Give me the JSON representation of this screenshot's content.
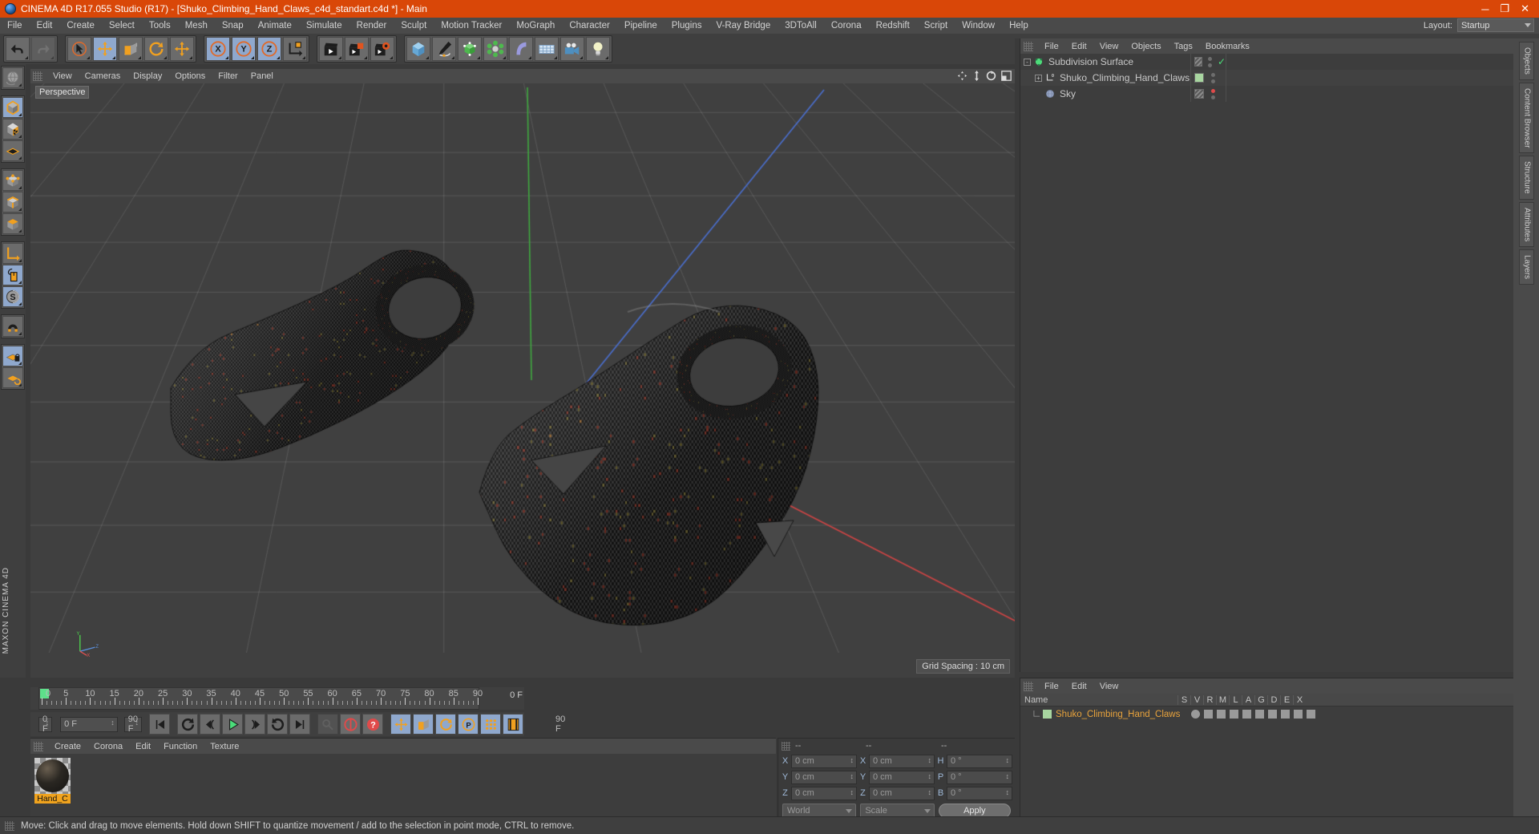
{
  "window": {
    "title": "CINEMA 4D R17.055 Studio (R17) - [Shuko_Climbing_Hand_Claws_c4d_standart.c4d *] - Main",
    "minimize": "─",
    "maximize": "❐",
    "close": "✕"
  },
  "menubar": {
    "items": [
      "File",
      "Edit",
      "Create",
      "Select",
      "Tools",
      "Mesh",
      "Snap",
      "Animate",
      "Simulate",
      "Render",
      "Sculpt",
      "Motion Tracker",
      "MoGraph",
      "Character",
      "Pipeline",
      "Plugins",
      "V-Ray Bridge",
      "3DToAll",
      "Corona",
      "Redshift",
      "Script",
      "Window",
      "Help"
    ],
    "layout_label": "Layout:",
    "layout_value": "Startup"
  },
  "toolbar": {
    "groups": [
      {
        "name": "undo-redo",
        "buttons": [
          {
            "name": "undo-button",
            "icon": "undo",
            "state": "normal"
          },
          {
            "name": "redo-button",
            "icon": "redo",
            "state": "disabled"
          }
        ]
      },
      {
        "name": "transform-tools",
        "buttons": [
          {
            "name": "live-selection-tool",
            "icon": "cursor",
            "state": "normal"
          },
          {
            "name": "move-tool",
            "icon": "move",
            "state": "active"
          },
          {
            "name": "scale-tool",
            "icon": "scale",
            "state": "normal"
          },
          {
            "name": "rotate-tool",
            "icon": "rotate",
            "state": "normal"
          },
          {
            "name": "move-alt-tool",
            "icon": "move",
            "state": "normal"
          }
        ]
      },
      {
        "name": "axis-locks",
        "buttons": [
          {
            "name": "lock-x-axis",
            "icon": "X",
            "state": "active"
          },
          {
            "name": "lock-y-axis",
            "icon": "Y",
            "state": "active"
          },
          {
            "name": "lock-z-axis",
            "icon": "Z",
            "state": "active"
          },
          {
            "name": "world-object-coordinates",
            "icon": "axis-cube",
            "state": "normal"
          }
        ]
      },
      {
        "name": "render-tools",
        "buttons": [
          {
            "name": "render-view-button",
            "icon": "clapper",
            "state": "normal"
          },
          {
            "name": "render-to-picture-viewer-button",
            "icon": "clapper-pv",
            "state": "normal"
          },
          {
            "name": "render-settings-button",
            "icon": "clapper-gear",
            "state": "normal"
          }
        ]
      },
      {
        "name": "create-objects",
        "buttons": [
          {
            "name": "add-cube-button",
            "icon": "cube",
            "state": "normal"
          },
          {
            "name": "add-spline-button",
            "icon": "pen",
            "state": "normal"
          },
          {
            "name": "add-generator-button",
            "icon": "generator",
            "state": "normal"
          },
          {
            "name": "add-deformer-button",
            "icon": "deformer",
            "state": "normal"
          },
          {
            "name": "add-bend-button",
            "icon": "bend",
            "state": "normal"
          },
          {
            "name": "add-floor-button",
            "icon": "floor",
            "state": "normal"
          },
          {
            "name": "add-camera-button",
            "icon": "camera",
            "state": "normal"
          },
          {
            "name": "add-light-button",
            "icon": "light",
            "state": "normal"
          }
        ]
      }
    ]
  },
  "left_toolbar": {
    "groups": [
      [
        {
          "name": "undo-view-button",
          "icon": "globe",
          "state": "normal"
        }
      ],
      [
        {
          "name": "model-mode-button",
          "icon": "model-cube",
          "state": "active"
        },
        {
          "name": "texture-mode-button",
          "icon": "texture-cube",
          "state": "normal"
        },
        {
          "name": "workplane-mode-button",
          "icon": "workplane",
          "state": "normal"
        }
      ],
      [
        {
          "name": "points-mode-button",
          "icon": "points-cube",
          "state": "normal"
        },
        {
          "name": "edges-mode-button",
          "icon": "edges-cube",
          "state": "normal"
        },
        {
          "name": "polygons-mode-button",
          "icon": "polygons-cube",
          "state": "normal"
        }
      ],
      [
        {
          "name": "object-axis-mode-button",
          "icon": "axis",
          "state": "normal"
        },
        {
          "name": "enable-axis-modification-button",
          "icon": "mouse",
          "state": "active"
        },
        {
          "name": "soft-selection-button",
          "icon": "s-disc",
          "state": "active"
        }
      ],
      [
        {
          "name": "snap-settings-button",
          "icon": "magnet",
          "state": "normal"
        }
      ],
      [
        {
          "name": "workplane-lock-button",
          "icon": "plane-lock",
          "state": "active"
        },
        {
          "name": "planar-workplane-button",
          "icon": "plane-rotate",
          "state": "normal"
        }
      ]
    ],
    "brand": "MAXON  CINEMA 4D"
  },
  "viewport": {
    "menu": [
      "View",
      "Cameras",
      "Display",
      "Options",
      "Filter",
      "Panel"
    ],
    "label": "Perspective",
    "grid_spacing": "Grid Spacing : 10 cm",
    "nav_icons": [
      "pan-icon",
      "dolly-icon",
      "orbit-icon",
      "maximize-viewport-icon"
    ],
    "axis": {
      "x": "X",
      "y": "Y",
      "z": "Z"
    }
  },
  "object_manager": {
    "menu": [
      "File",
      "Edit",
      "View",
      "Objects",
      "Tags",
      "Bookmarks"
    ],
    "rows": [
      {
        "name": "Subdivision Surface",
        "icon": "subdivision-surface-icon",
        "depth": 0,
        "expander": "-",
        "tag": "hatched",
        "check": true
      },
      {
        "name": "Shuko_Climbing_Hand_Claws",
        "icon": "null-object-icon",
        "depth": 1,
        "expander": "+",
        "tag": "green",
        "check": false
      },
      {
        "name": "Sky",
        "icon": "sky-icon",
        "depth": 1,
        "expander": "",
        "tag": "hatched",
        "check": false,
        "reddot": true
      }
    ]
  },
  "timeline": {
    "ticks": [
      {
        "label": "0",
        "frame": 0
      },
      {
        "label": "5",
        "frame": 5
      },
      {
        "label": "10",
        "frame": 10
      },
      {
        "label": "15",
        "frame": 15
      },
      {
        "label": "20",
        "frame": 20
      },
      {
        "label": "25",
        "frame": 25
      },
      {
        "label": "30",
        "frame": 30
      },
      {
        "label": "35",
        "frame": 35
      },
      {
        "label": "40",
        "frame": 40
      },
      {
        "label": "45",
        "frame": 45
      },
      {
        "label": "50",
        "frame": 50
      },
      {
        "label": "55",
        "frame": 55
      },
      {
        "label": "60",
        "frame": 60
      },
      {
        "label": "65",
        "frame": 65
      },
      {
        "label": "70",
        "frame": 70
      },
      {
        "label": "75",
        "frame": 75
      },
      {
        "label": "80",
        "frame": 80
      },
      {
        "label": "85",
        "frame": 85
      },
      {
        "label": "90",
        "frame": 90
      }
    ],
    "max_frame": 90,
    "end_field": "0 F"
  },
  "playback": {
    "current_frame_field": "0 F",
    "start_frame_field": "0 F",
    "preview_end_field": "90 F",
    "end_frame_field": "90 F",
    "buttons": [
      {
        "name": "go-to-start-button",
        "icon": "skip-start",
        "state": "normal"
      },
      {
        "name": "play-backwards-button",
        "icon": "rewind-loop",
        "state": "normal"
      },
      {
        "name": "previous-frame-button",
        "icon": "step-back",
        "state": "normal"
      },
      {
        "name": "play-button",
        "icon": "play",
        "state": "normal"
      },
      {
        "name": "next-frame-button",
        "icon": "step-forward",
        "state": "normal"
      },
      {
        "name": "play-forwards-button",
        "icon": "forward-loop",
        "state": "normal"
      },
      {
        "name": "go-to-end-button",
        "icon": "skip-end",
        "state": "normal"
      },
      {
        "name": "record-active-objects-button",
        "icon": "key",
        "state": "disabled"
      },
      {
        "name": "autokeying-button",
        "icon": "autokey",
        "state": "normal"
      },
      {
        "name": "keyframe-selection-button",
        "icon": "question",
        "state": "normal"
      },
      {
        "name": "position-key-button",
        "icon": "move",
        "state": "active"
      },
      {
        "name": "scale-key-button",
        "icon": "scale",
        "state": "active"
      },
      {
        "name": "rotation-key-button",
        "icon": "rotate",
        "state": "active"
      },
      {
        "name": "parameter-key-button",
        "icon": "p-circle",
        "state": "active"
      },
      {
        "name": "point-level-animation-button",
        "icon": "dots",
        "state": "active"
      },
      {
        "name": "timeline-strip-button",
        "icon": "filmstrip",
        "state": "active"
      }
    ]
  },
  "material_manager": {
    "menu": [
      "Create",
      "Corona",
      "Edit",
      "Function",
      "Texture"
    ],
    "materials": [
      {
        "name": "Hand_C",
        "preview": "dark-sphere"
      }
    ]
  },
  "coordinates": {
    "header": [
      "--",
      "--",
      "--"
    ],
    "rows": [
      {
        "pos_label": "X",
        "pos_value": "0 cm",
        "size_label": "X",
        "size_value": "0 cm",
        "rot_label": "H",
        "rot_value": "0 °"
      },
      {
        "pos_label": "Y",
        "pos_value": "0 cm",
        "size_label": "Y",
        "size_value": "0 cm",
        "rot_label": "P",
        "rot_value": "0 °"
      },
      {
        "pos_label": "Z",
        "pos_value": "0 cm",
        "size_label": "Z",
        "size_value": "0 cm",
        "rot_label": "B",
        "rot_value": "0 °"
      }
    ],
    "coord_system": "World",
    "size_mode": "Scale",
    "apply_label": "Apply"
  },
  "attribute_manager": {
    "menu": [
      "File",
      "Edit",
      "View"
    ],
    "columns": [
      "Name",
      "S",
      "V",
      "R",
      "M",
      "L",
      "A",
      "G",
      "D",
      "E",
      "X"
    ],
    "rows": [
      {
        "name": "Shuko_Climbing_Hand_Claws",
        "icons": [
          "selection-dot-icon",
          "visible-icon",
          "render-icon",
          "motion-icon",
          "lock-icon",
          "anim-icon",
          "g-icon",
          "deform-icon",
          "e-icon",
          "x-icon"
        ]
      }
    ]
  },
  "right_tabs": [
    "Objects",
    "Content Browser",
    "Structure",
    "Attributes",
    "Layers"
  ],
  "statusbar": {
    "message": "Move: Click and drag to move elements. Hold down SHIFT to quantize movement / add to the selection in point mode, CTRL to remove."
  }
}
